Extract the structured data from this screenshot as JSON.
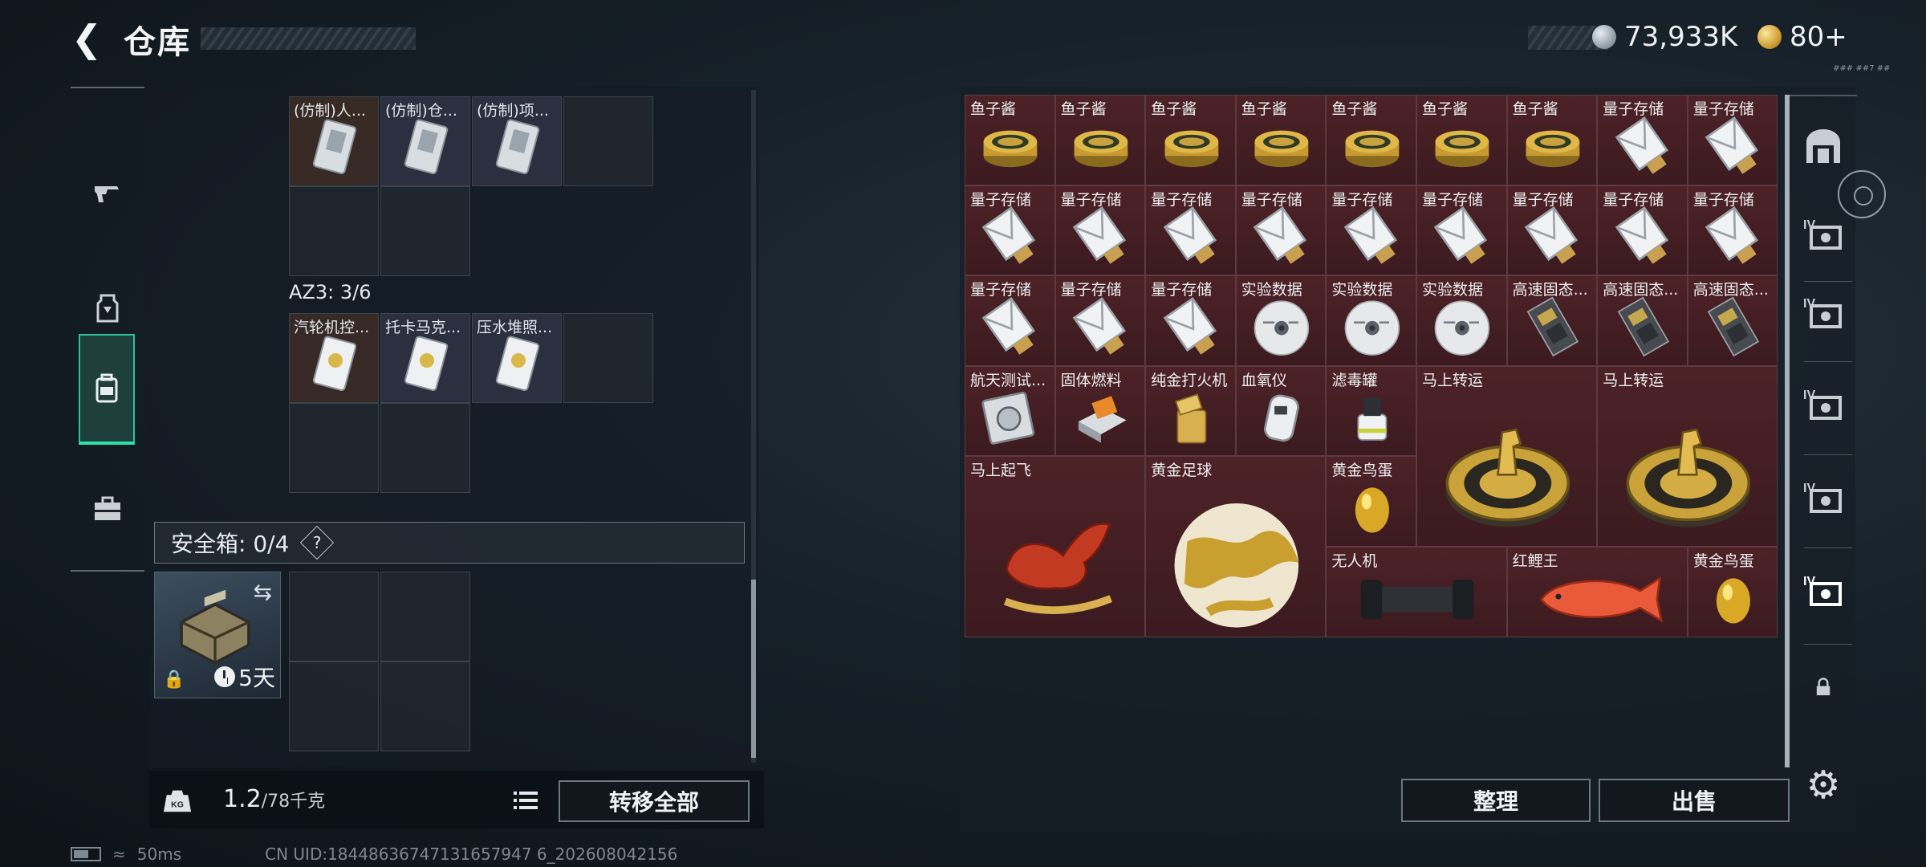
{
  "header": {
    "title": "仓库",
    "silver_amount": "73,933K",
    "gold_amount": "80+",
    "version_text": "### ##7 ##"
  },
  "left_nav": {
    "items": [
      "weapon",
      "armor",
      "backpack",
      "toolbox"
    ]
  },
  "left_panel": {
    "top_slots": [
      "(仿制)人...",
      "(仿制)仓...",
      "(仿制)项..."
    ],
    "az3_label": "AZ3: 3/6",
    "az3_slots": [
      "汽轮机控...",
      "托卡马克...",
      "压水堆照..."
    ],
    "safe_box_label": "安全箱: 0/4",
    "safe_box_help": "?",
    "safe_case_timer": "5天",
    "weight_current": "1.2",
    "weight_max": "/78千克",
    "transfer_all": "转移全部"
  },
  "right_panel": {
    "sort_label": "整理",
    "sell_label": "出售",
    "items": [
      {
        "label": "鱼子酱",
        "type": "caviar"
      },
      {
        "label": "鱼子酱",
        "type": "caviar"
      },
      {
        "label": "鱼子酱",
        "type": "caviar"
      },
      {
        "label": "鱼子酱",
        "type": "caviar"
      },
      {
        "label": "鱼子酱",
        "type": "caviar"
      },
      {
        "label": "鱼子酱",
        "type": "caviar"
      },
      {
        "label": "鱼子酱",
        "type": "caviar"
      },
      {
        "label": "量子存储",
        "type": "usb"
      },
      {
        "label": "量子存储",
        "type": "usb"
      },
      {
        "label": "量子存储",
        "type": "usb"
      },
      {
        "label": "量子存储",
        "type": "usb"
      },
      {
        "label": "量子存储",
        "type": "usb"
      },
      {
        "label": "量子存储",
        "type": "usb"
      },
      {
        "label": "量子存储",
        "type": "usb"
      },
      {
        "label": "量子存储",
        "type": "usb"
      },
      {
        "label": "量子存储",
        "type": "usb"
      },
      {
        "label": "量子存储",
        "type": "usb"
      },
      {
        "label": "量子存储",
        "type": "usb"
      },
      {
        "label": "量子存储",
        "type": "usb"
      },
      {
        "label": "量子存储",
        "type": "usb"
      },
      {
        "label": "量子存储",
        "type": "usb"
      },
      {
        "label": "实验数据",
        "type": "disc"
      },
      {
        "label": "实验数据",
        "type": "disc"
      },
      {
        "label": "实验数据",
        "type": "disc"
      },
      {
        "label": "高速固态...",
        "type": "ssd"
      },
      {
        "label": "高速固态...",
        "type": "ssd"
      },
      {
        "label": "高速固态...",
        "type": "ssd"
      },
      {
        "label": "航天测试...",
        "type": "device"
      },
      {
        "label": "固体燃料",
        "type": "fuel"
      },
      {
        "label": "纯金打火机",
        "type": "lighter"
      },
      {
        "label": "血氧仪",
        "type": "oximeter"
      },
      {
        "label": "滤毒罐",
        "type": "filter"
      },
      {
        "label": "马上转运",
        "type": "horse_coin"
      },
      {
        "label": "马上转运",
        "type": "horse_coin"
      },
      {
        "label": "马上起飞",
        "type": "red_horse"
      },
      {
        "label": "黄金足球",
        "type": "gold_ball"
      },
      {
        "label": "黄金鸟蛋",
        "type": "gold_egg"
      },
      {
        "label": "无人机",
        "type": "drone"
      },
      {
        "label": "红鲤王",
        "type": "carp"
      },
      {
        "label": "黄金鸟蛋",
        "type": "gold_egg"
      }
    ]
  },
  "status_bar": {
    "ping": "50ms",
    "uid": "CN UID:18448636747131657947 6_202608042156"
  },
  "colors": {
    "accent": "#2ee0ae",
    "item_bg": "#4d2227",
    "panel_bg": "#16202a"
  }
}
